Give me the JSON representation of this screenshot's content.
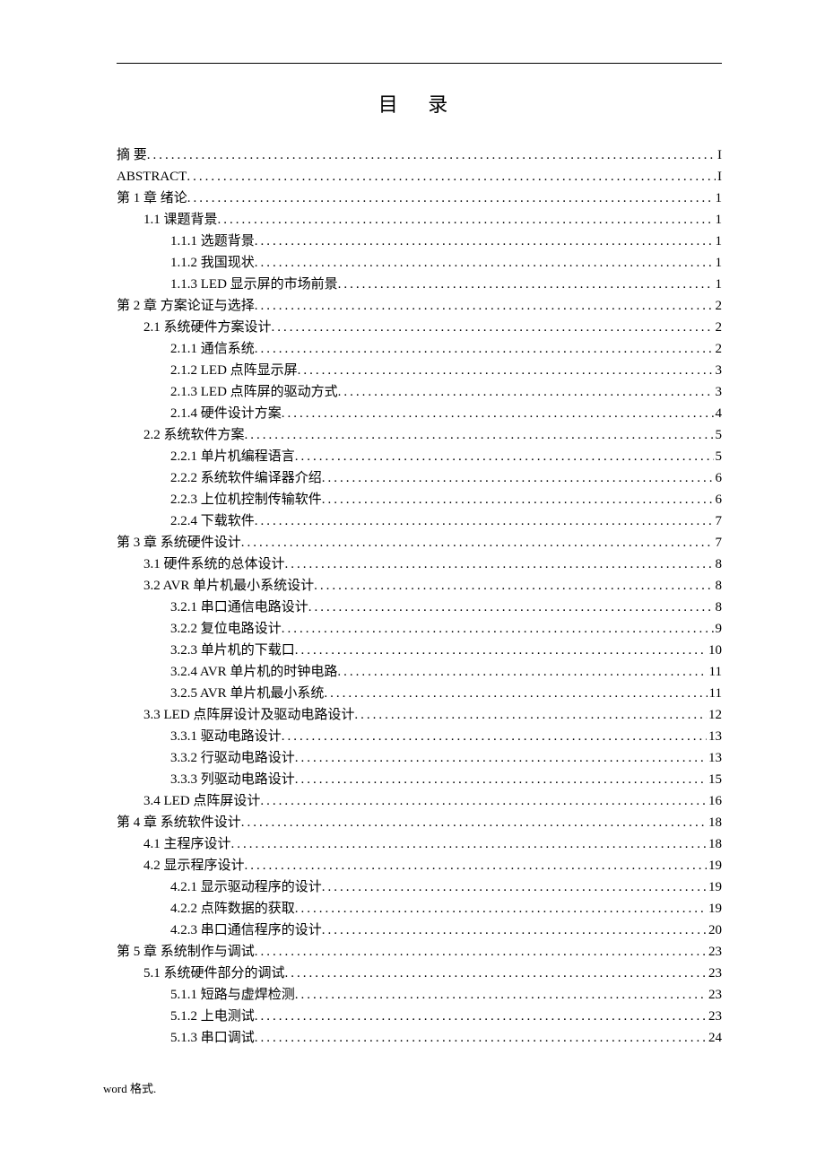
{
  "title": "目 录",
  "footer": "word 格式.",
  "toc": [
    {
      "level": 0,
      "label": "摘   要",
      "page": "I"
    },
    {
      "level": 0,
      "label": "ABSTRACT",
      "page": "I"
    },
    {
      "level": 0,
      "label": "第 1 章   绪论",
      "page": "1"
    },
    {
      "level": 1,
      "label": "1.1   课题背景 ",
      "page": "1"
    },
    {
      "level": 2,
      "label": "1.1.1   选题背景",
      "page": "1"
    },
    {
      "level": 2,
      "label": "1.1.2   我国现状",
      "page": "1"
    },
    {
      "level": 2,
      "label": "1.1.3   LED 显示屏的市场前景 ",
      "page": "1"
    },
    {
      "level": 0,
      "label": "第 2 章   方案论证与选择",
      "page": "2"
    },
    {
      "level": 1,
      "label": "2.1   系统硬件方案设计 ",
      "page": "2"
    },
    {
      "level": 2,
      "label": "2.1.1   通信系统",
      "page": "2"
    },
    {
      "level": 2,
      "label": "2.1.2   LED 点阵显示屏 ",
      "page": "3"
    },
    {
      "level": 2,
      "label": "2.1.3   LED 点阵屏的驱动方式 ",
      "page": "3"
    },
    {
      "level": 2,
      "label": "2.1.4   硬件设计方案",
      "page": "4"
    },
    {
      "level": 1,
      "label": "2.2   系统软件方案 ",
      "page": "5"
    },
    {
      "level": 2,
      "label": "2.2.1   单片机编程语言",
      "page": "5"
    },
    {
      "level": 2,
      "label": "2.2.2   系统软件编译器介绍",
      "page": "6"
    },
    {
      "level": 2,
      "label": "2.2.3   上位机控制传输软件",
      "page": "6"
    },
    {
      "level": 2,
      "label": "2.2.4   下载软件",
      "page": "7"
    },
    {
      "level": 0,
      "label": "第 3 章  系统硬件设计",
      "page": "7"
    },
    {
      "level": 1,
      "label": "3.1   硬件系统的总体设计 ",
      "page": "8"
    },
    {
      "level": 1,
      "label": "3.2   AVR 单片机最小系统设计",
      "page": "8"
    },
    {
      "level": 2,
      "label": "3.2.1   串口通信电路设计",
      "page": "8"
    },
    {
      "level": 2,
      "label": "3.2.2   复位电路设计",
      "page": "9"
    },
    {
      "level": 2,
      "label": "3.2.3   单片机的下载口",
      "page": "10"
    },
    {
      "level": 2,
      "label": "3.2.4   AVR 单片机的时钟电路 ",
      "page": "11"
    },
    {
      "level": 2,
      "label": "3.2.5   AVR 单片机最小系统 ",
      "page": "11"
    },
    {
      "level": 1,
      "label": "3.3    LED 点阵屏设计及驱动电路设计",
      "page": "12"
    },
    {
      "level": 2,
      "label": "3.3.1   驱动电路设计",
      "page": "13"
    },
    {
      "level": 2,
      "label": "3.3.2   行驱动电路设计",
      "page": "13"
    },
    {
      "level": 2,
      "label": "3.3.3   列驱动电路设计",
      "page": "15"
    },
    {
      "level": 1,
      "label": "3.4   LED 点阵屏设计",
      "page": "16"
    },
    {
      "level": 0,
      "label": "第 4 章   系统软件设计",
      "page": "18"
    },
    {
      "level": 1,
      "label": "4.1   主程序设计 ",
      "page": "18"
    },
    {
      "level": 1,
      "label": "4.2   显示程序设计 ",
      "page": "19"
    },
    {
      "level": 2,
      "label": "4.2.1   显示驱动程序的设计",
      "page": "19"
    },
    {
      "level": 2,
      "label": "4.2.2   点阵数据的获取",
      "page": "19"
    },
    {
      "level": 2,
      "label": "4.2.3   串口通信程序的设计",
      "page": "20"
    },
    {
      "level": 0,
      "label": "第 5 章   系统制作与调试",
      "page": "23"
    },
    {
      "level": 1,
      "label": "5.1 系统硬件部分的调试 ",
      "page": "23"
    },
    {
      "level": 2,
      "label": "5.1.1   短路与虚焊检测",
      "page": "23"
    },
    {
      "level": 2,
      "label": "5.1.2   上电测试",
      "page": "23"
    },
    {
      "level": 2,
      "label": "5.1.3   串口调试",
      "page": "24"
    }
  ]
}
